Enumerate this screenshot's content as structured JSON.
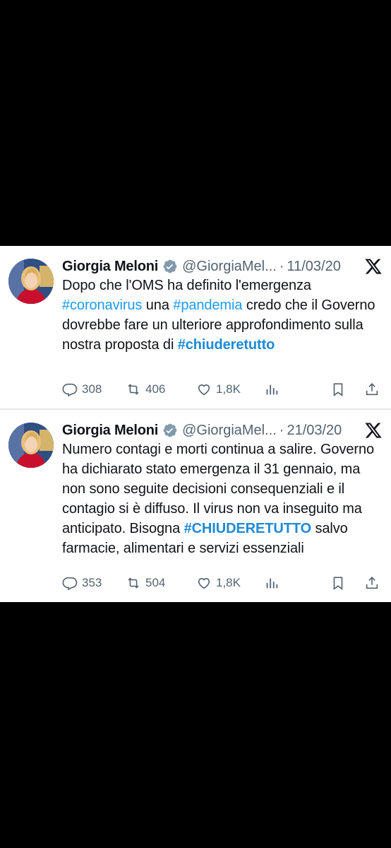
{
  "tweets": [
    {
      "name": "Giorgia Meloni",
      "handle": "@GiorgiaMel...",
      "separator": "·",
      "date": "11/03/20",
      "text_parts": [
        {
          "t": "Dopo che l'OMS ha definito l'emergenza ",
          "type": "text"
        },
        {
          "t": "#coronavirus",
          "type": "tag"
        },
        {
          "t": " una ",
          "type": "text"
        },
        {
          "t": "#pandemia",
          "type": "tag"
        },
        {
          "t": " credo che il Governo dovrebbe fare un ulteriore approfondimento sulla nostra proposta di ",
          "type": "text"
        },
        {
          "t": "#chiuderetutto",
          "type": "tagbold"
        }
      ],
      "replies": "308",
      "retweets": "406",
      "likes": "1,8K"
    },
    {
      "name": "Giorgia Meloni",
      "handle": "@GiorgiaMel...",
      "separator": "·",
      "date": "21/03/20",
      "text_parts": [
        {
          "t": "Numero contagi e morti continua a salire. Governo ha dichiarato stato emergenza il 31 gennaio, ma non sono seguite decisioni consequenziali e il contagio si è diffuso. Il virus non va inseguito ma anticipato. Bisogna ",
          "type": "text"
        },
        {
          "t": "#CHIUDERETUTTO",
          "type": "tagbold"
        },
        {
          "t": " salvo farmacie, alimentari e servizi essenziali",
          "type": "text"
        }
      ],
      "replies": "353",
      "retweets": "504",
      "likes": "1,8K"
    }
  ],
  "icons": {
    "verified": "verified-badge-icon",
    "x_logo": "x-logo-icon",
    "reply": "reply-icon",
    "retweet": "retweet-icon",
    "like": "heart-icon",
    "views": "analytics-icon",
    "bookmark": "bookmark-icon",
    "share": "share-icon"
  },
  "colors": {
    "link": "#1d9bf0",
    "muted": "#536471",
    "text": "#0f1419",
    "background": "#000000"
  }
}
